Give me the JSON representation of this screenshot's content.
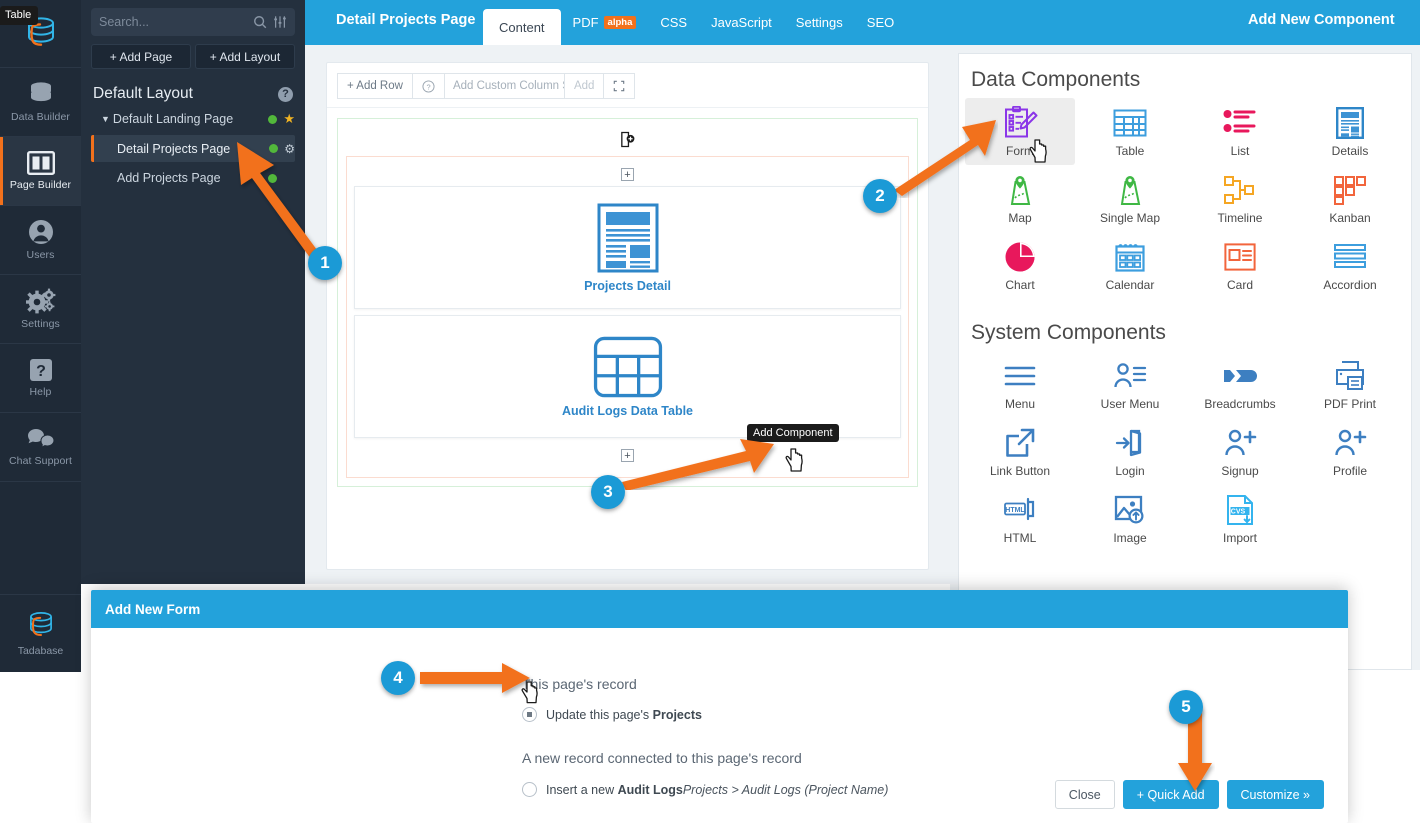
{
  "rail": {
    "tooltip": "Table",
    "items": [
      {
        "label": "Data Builder",
        "icon": "database-icon"
      },
      {
        "label": "Page Builder",
        "icon": "layout-icon"
      },
      {
        "label": "Users",
        "icon": "user-icon"
      },
      {
        "label": "Settings",
        "icon": "gears-icon"
      },
      {
        "label": "Help",
        "icon": "question-box-icon"
      },
      {
        "label": "Chat Support",
        "icon": "chat-bubbles-icon"
      }
    ],
    "active_label": "Page Builder",
    "bottom": {
      "label": "Tadabase",
      "icon": "tadabase-logo-icon"
    }
  },
  "tree": {
    "search_placeholder": "Search...",
    "add_page": "+ Add Page",
    "add_layout": "+ Add Layout",
    "layout_title": "Default Layout",
    "nodes": [
      {
        "label": "Default Landing Page",
        "level": 0,
        "dot": true,
        "star": true,
        "selected": false
      },
      {
        "label": "Detail Projects Page",
        "level": 1,
        "dot": true,
        "gear": true,
        "selected": true
      },
      {
        "label": "Add Projects Page",
        "level": 1,
        "dot": true,
        "selected": false
      }
    ]
  },
  "topbar": {
    "title": "Detail Projects Page",
    "tabs": [
      {
        "label": "Content",
        "active": true
      },
      {
        "label": "PDF",
        "badge": "alpha",
        "active": false
      },
      {
        "label": "CSS",
        "active": false
      },
      {
        "label": "JavaScript",
        "active": false
      },
      {
        "label": "Settings",
        "active": false
      },
      {
        "label": "SEO",
        "active": false
      }
    ],
    "right_title": "Add New Component"
  },
  "canvas": {
    "toolbar": {
      "add_row": "+ Add Row",
      "help": "?",
      "column_size_placeholder": "Add Custom Column Size",
      "add": "Add",
      "expand": "expand-icon"
    },
    "components": [
      {
        "name": "Projects Detail",
        "icon": "details-doc-icon"
      },
      {
        "name": "Audit Logs Data Table",
        "icon": "table-grid-icon"
      }
    ],
    "add_component_tooltip": "Add Component"
  },
  "right_panel": {
    "data_components_title": "Data Components",
    "data_components": [
      {
        "label": "Form",
        "icon": "form-clipboard-icon",
        "highlighted": true
      },
      {
        "label": "Table",
        "icon": "table-icon",
        "highlighted": false
      },
      {
        "label": "List",
        "icon": "list-icon",
        "highlighted": false
      },
      {
        "label": "Details",
        "icon": "details-icon",
        "highlighted": false
      },
      {
        "label": "Map",
        "icon": "map-icon",
        "highlighted": false
      },
      {
        "label": "Single Map",
        "icon": "single-map-icon",
        "highlighted": false
      },
      {
        "label": "Timeline",
        "icon": "timeline-icon",
        "highlighted": false
      },
      {
        "label": "Kanban",
        "icon": "kanban-icon",
        "highlighted": false
      },
      {
        "label": "Chart",
        "icon": "pie-chart-icon",
        "highlighted": false
      },
      {
        "label": "Calendar",
        "icon": "calendar-icon",
        "highlighted": false
      },
      {
        "label": "Card",
        "icon": "card-icon",
        "highlighted": false
      },
      {
        "label": "Accordion",
        "icon": "accordion-icon",
        "highlighted": false
      }
    ],
    "system_components_title": "System Components",
    "system_components": [
      {
        "label": "Menu",
        "icon": "menu-icon"
      },
      {
        "label": "User Menu",
        "icon": "user-menu-icon"
      },
      {
        "label": "Breadcrumbs",
        "icon": "breadcrumbs-icon"
      },
      {
        "label": "PDF Print",
        "icon": "printer-icon"
      },
      {
        "label": "Link Button",
        "icon": "external-link-icon"
      },
      {
        "label": "Login",
        "icon": "login-icon"
      },
      {
        "label": "Signup",
        "icon": "user-plus-icon"
      },
      {
        "label": "Profile",
        "icon": "profile-icon"
      },
      {
        "label": "HTML",
        "icon": "html-icon"
      },
      {
        "label": "Image",
        "icon": "image-upload-icon"
      },
      {
        "label": "Import",
        "icon": "csv-import-icon"
      }
    ]
  },
  "modal": {
    "title": "Add New Form",
    "section_1_label": "This page's record",
    "option_1": {
      "prefix": "Update this page's ",
      "bold": "Projects",
      "selected": true
    },
    "section_2_label": "A new record connected to this page's record",
    "option_2": {
      "prefix": "Insert a new ",
      "bold": "Audit Logs",
      "italic": "Projects > Audit Logs (Project Name)",
      "selected": false
    },
    "buttons": {
      "close": "Close",
      "quick_add": "+ Quick Add",
      "customize": "Customize »"
    }
  },
  "callouts": [
    {
      "number": "1"
    },
    {
      "number": "2"
    },
    {
      "number": "3"
    },
    {
      "number": "4"
    },
    {
      "number": "5"
    }
  ],
  "colors": {
    "brand_blue": "#23a2db",
    "accent_orange": "#f2711c",
    "rail_bg": "#1f2a37",
    "tree_bg": "#24303e",
    "callout_blue": "#1b9ad6"
  }
}
